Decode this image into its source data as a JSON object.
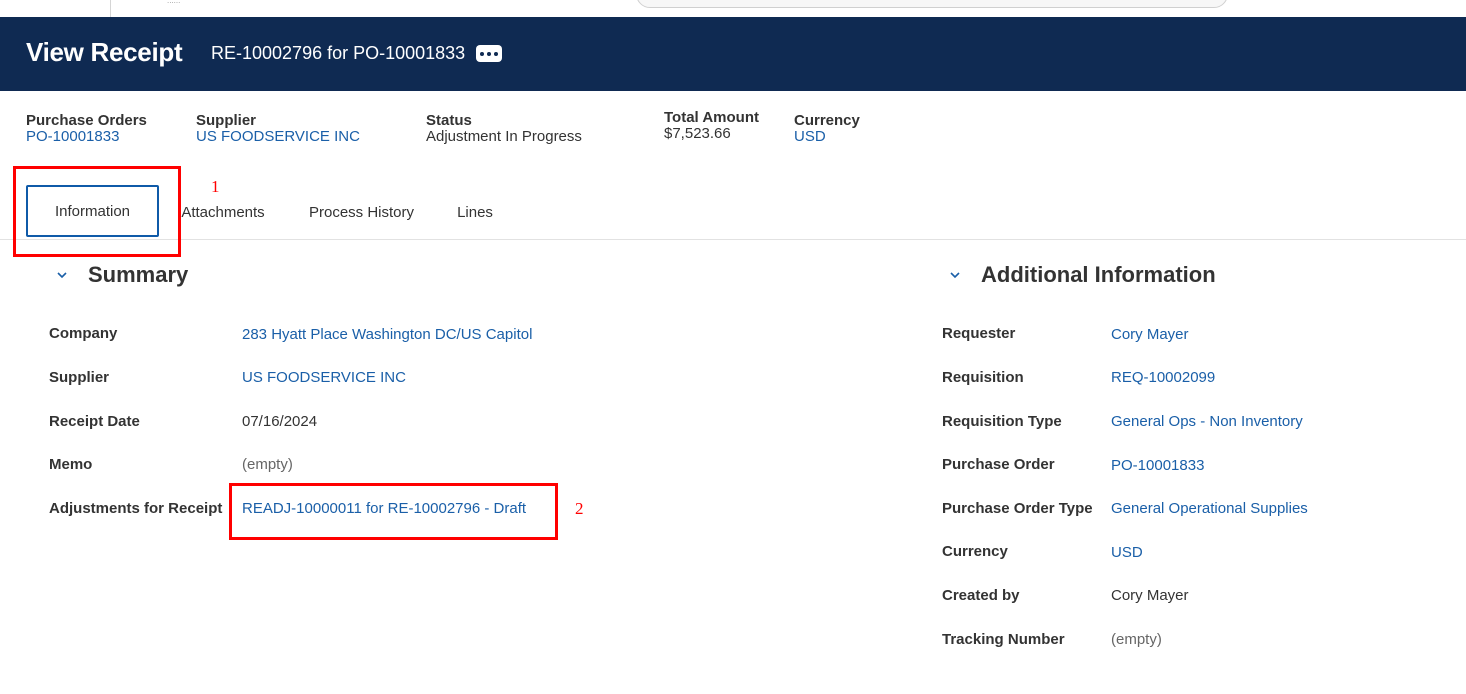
{
  "top_strip": {
    "tiny_text": "......"
  },
  "header": {
    "title": "View Receipt",
    "subtitle": "RE-10002796 for PO-10001833",
    "more_button_icon": "ellipsis-icon"
  },
  "header_fields": {
    "purchase_orders": {
      "label": "Purchase Orders",
      "value": "PO-10001833"
    },
    "supplier": {
      "label": "Supplier",
      "value": "US FOODSERVICE INC"
    },
    "status": {
      "label": "Status",
      "value": "Adjustment In Progress"
    },
    "total_amount": {
      "label": "Total Amount",
      "value": "$7,523.66"
    },
    "currency": {
      "label": "Currency",
      "value": "USD"
    }
  },
  "tabs": [
    {
      "label": "Information",
      "active": true
    },
    {
      "label": "Attachments",
      "active": false
    },
    {
      "label": "Process History",
      "active": false
    },
    {
      "label": "Lines",
      "active": false
    }
  ],
  "annotations": {
    "one": "1",
    "two": "2",
    "color": "#ff0000"
  },
  "summary": {
    "title": "Summary",
    "rows": [
      {
        "label": "Company",
        "value": "283 Hyatt Place Washington DC/US Capitol",
        "kind": "link"
      },
      {
        "label": "Supplier",
        "value": "US FOODSERVICE INC",
        "kind": "link"
      },
      {
        "label": "Receipt Date",
        "value": "07/16/2024",
        "kind": "text"
      },
      {
        "label": "Memo",
        "value": "(empty)",
        "kind": "empty"
      },
      {
        "label": "Adjustments for Receipt",
        "value": "READJ-10000011 for RE-10002796 - Draft",
        "kind": "link"
      }
    ]
  },
  "additional": {
    "title": "Additional Information",
    "rows": [
      {
        "label": "Requester",
        "value": "Cory Mayer",
        "kind": "link"
      },
      {
        "label": "Requisition",
        "value": "REQ-10002099",
        "kind": "link"
      },
      {
        "label": "Requisition Type",
        "value": "General Ops - Non Inventory",
        "kind": "link"
      },
      {
        "label": "Purchase Order",
        "value": "PO-10001833",
        "kind": "link"
      },
      {
        "label": "Purchase Order Type",
        "value": "General Operational Supplies",
        "kind": "link"
      },
      {
        "label": "Currency",
        "value": "USD",
        "kind": "link"
      },
      {
        "label": "Created by",
        "value": "Cory Mayer",
        "kind": "text"
      },
      {
        "label": "Tracking Number",
        "value": "(empty)",
        "kind": "empty"
      }
    ]
  },
  "colors": {
    "header_bg": "#0f2a52",
    "link": "#1a5fa8",
    "active_tab_border": "#0f5aa8"
  }
}
